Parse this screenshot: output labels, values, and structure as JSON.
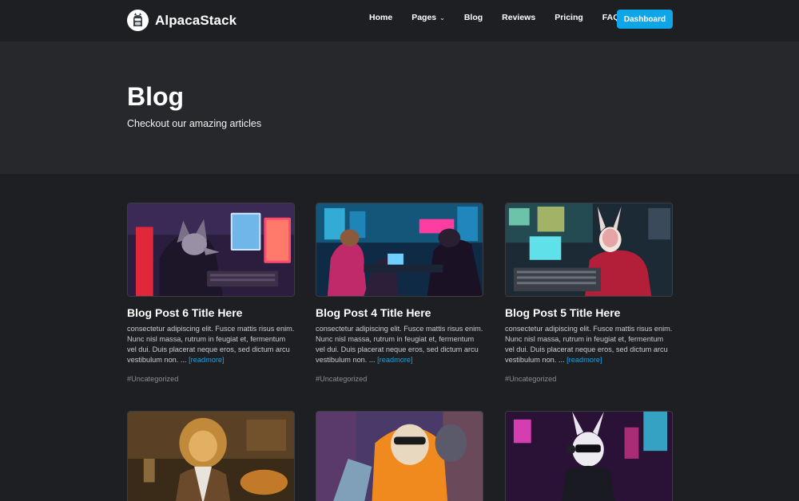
{
  "nav": {
    "brand": "AlpacaStack",
    "links": [
      "Home",
      "Pages",
      "Blog",
      "Reviews",
      "Pricing",
      "FAQ"
    ],
    "cta": "Dashboard"
  },
  "hero": {
    "title": "Blog",
    "subtitle": "Checkout our amazing articles"
  },
  "posts": [
    {
      "title": "Blog Post 6 Title Here",
      "excerpt": "consectetur adipiscing elit. Fusce mattis risus enim. Nunc nisl massa, rutrum in feugiat et, fermentum vel dui. Duis placerat neque eros, sed dictum arcu vestibulum non. ...",
      "readmore": "[readmore]",
      "tag": "#Uncategorized",
      "image": "wolf-hacker-at-computer"
    },
    {
      "title": "Blog Post 4 Title Here",
      "excerpt": "consectetur adipiscing elit. Fusce mattis risus enim. Nunc nisl massa, rutrum in feugiat et, fermentum vel dui. Duis placerat neque eros, sed dictum arcu vestibulum non. ...",
      "readmore": "[readmore]",
      "tag": "#Uncategorized",
      "image": "animals-in-cyber-office"
    },
    {
      "title": "Blog Post 5 Title Here",
      "excerpt": "consectetur adipiscing elit. Fusce mattis risus enim. Nunc nisl massa, rutrum in feugiat et, fermentum vel dui. Duis placerat neque eros, sed dictum arcu vestibulum non. ...",
      "readmore": "[readmore]",
      "tag": "#Uncategorized",
      "image": "rabbit-hacker-at-console"
    },
    {
      "image": "lion-in-lounge"
    },
    {
      "image": "sloth-in-orange-hoodie"
    },
    {
      "image": "neon-rabbit-with-headphones"
    }
  ]
}
